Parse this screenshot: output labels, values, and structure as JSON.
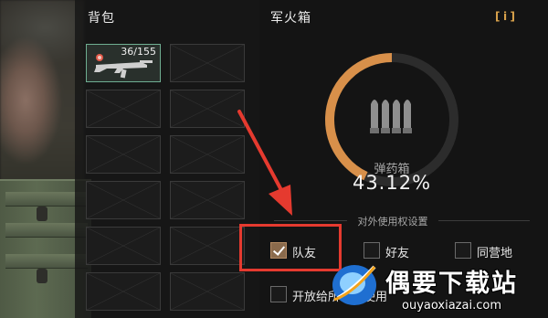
{
  "backpack": {
    "title": "背包",
    "weapon_count": "36/155",
    "empty_slots": 11
  },
  "supply_box": {
    "title": "军火箱",
    "info_label": "i",
    "gauge": {
      "label": "弹药箱",
      "value_text": "43.12%",
      "fill_fraction": 0.4312,
      "fill_color": "#d8904a",
      "track_color": "#2c2c2c"
    },
    "permissions": {
      "title": "对外使用权设置",
      "options": [
        {
          "label": "队友",
          "checked": true
        },
        {
          "label": "好友",
          "checked": false
        },
        {
          "label": "同营地",
          "checked": false
        },
        {
          "label": "开放给所有人使用",
          "checked": false
        }
      ]
    }
  },
  "annotation": {
    "highlight_color": "#e53a2f",
    "icon": "arrow-pointer-icon"
  },
  "watermark": {
    "title": "偶要下载站",
    "url": "ouyaoxiazai.com"
  }
}
